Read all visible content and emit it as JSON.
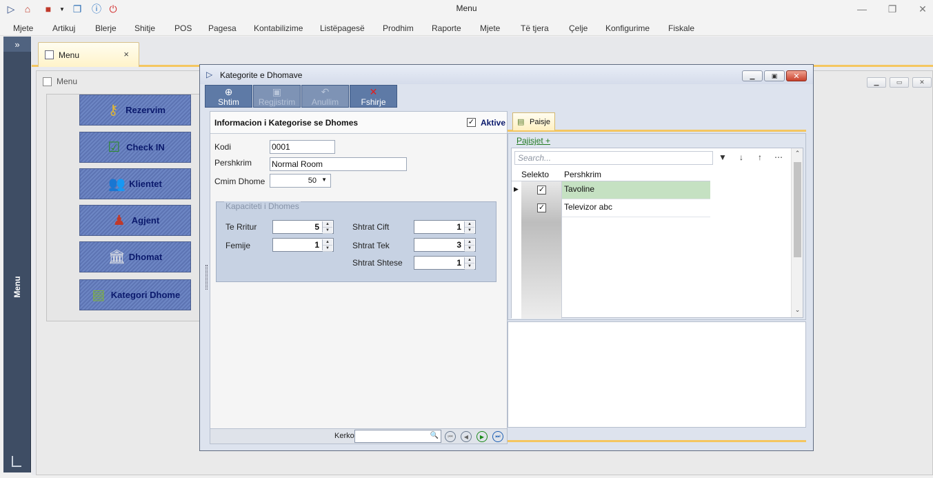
{
  "window": {
    "title": "Menu"
  },
  "menubar": [
    "Mjete",
    "Artikuj",
    "Blerje",
    "Shitje",
    "POS",
    "Pagesa",
    "Kontabilizime",
    "Listëpagesë",
    "Prodhim",
    "Raporte",
    "Mjete",
    "Të tjera",
    "Çelje",
    "Konfigurime",
    "Fiskale"
  ],
  "sidenav": {
    "toggle": "»",
    "label": "Menu"
  },
  "doc_tab": {
    "label": "Menu",
    "close": "×"
  },
  "menu_window": {
    "title": "Menu",
    "tiles": [
      {
        "label": "Rezervim",
        "icon": "key-icon"
      },
      {
        "label": "Check IN",
        "icon": "checklist-icon"
      },
      {
        "label": "Klientet",
        "icon": "clients-icon"
      },
      {
        "label": "Agjent",
        "icon": "agents-icon"
      },
      {
        "label": "Dhomat",
        "icon": "building-icon"
      },
      {
        "label": "Kategori Dhome",
        "icon": "ledger-icon"
      }
    ]
  },
  "dialog": {
    "title": "Kategorite e Dhomave",
    "toolbar": [
      {
        "label": "Shtim",
        "enabled": true,
        "icon": "add-icon"
      },
      {
        "label": "Regjistrim",
        "enabled": false,
        "icon": "save-icon"
      },
      {
        "label": "Anullim",
        "enabled": false,
        "icon": "undo-icon"
      },
      {
        "label": "Fshirje",
        "enabled": true,
        "icon": "delete-icon"
      }
    ],
    "form": {
      "header": "Informacion i Kategorise se Dhomes",
      "active_label": "Aktive",
      "active_checked": true,
      "kodi_label": "Kodi",
      "kodi_value": "0001",
      "pershkrim_label": "Pershkrim",
      "pershkrim_value": "Normal Room",
      "cmim_label": "Cmim Dhome",
      "cmim_value": "50",
      "capacity": {
        "title": "Kapaciteti i Dhomes",
        "te_rritur_label": "Te Rritur",
        "te_rritur": "5",
        "femije_label": "Femije",
        "femije": "1",
        "shtrat_cift_label": "Shtrat Cift",
        "shtrat_cift": "1",
        "shtrat_tek_label": "Shtrat Tek",
        "shtrat_tek": "3",
        "shtrat_shtese_label": "Shtrat Shtese",
        "shtrat_shtese": "1"
      },
      "footer": {
        "search_label": "Kerko"
      }
    },
    "right": {
      "tab": "Paisje",
      "link": "Pajisjet +",
      "search_placeholder": "Search...",
      "col_select": "Selekto",
      "col_desc": "Pershkrim",
      "rows": [
        {
          "checked": true,
          "desc": "Tavoline"
        },
        {
          "checked": true,
          "desc": "Televizor abc"
        }
      ]
    }
  }
}
